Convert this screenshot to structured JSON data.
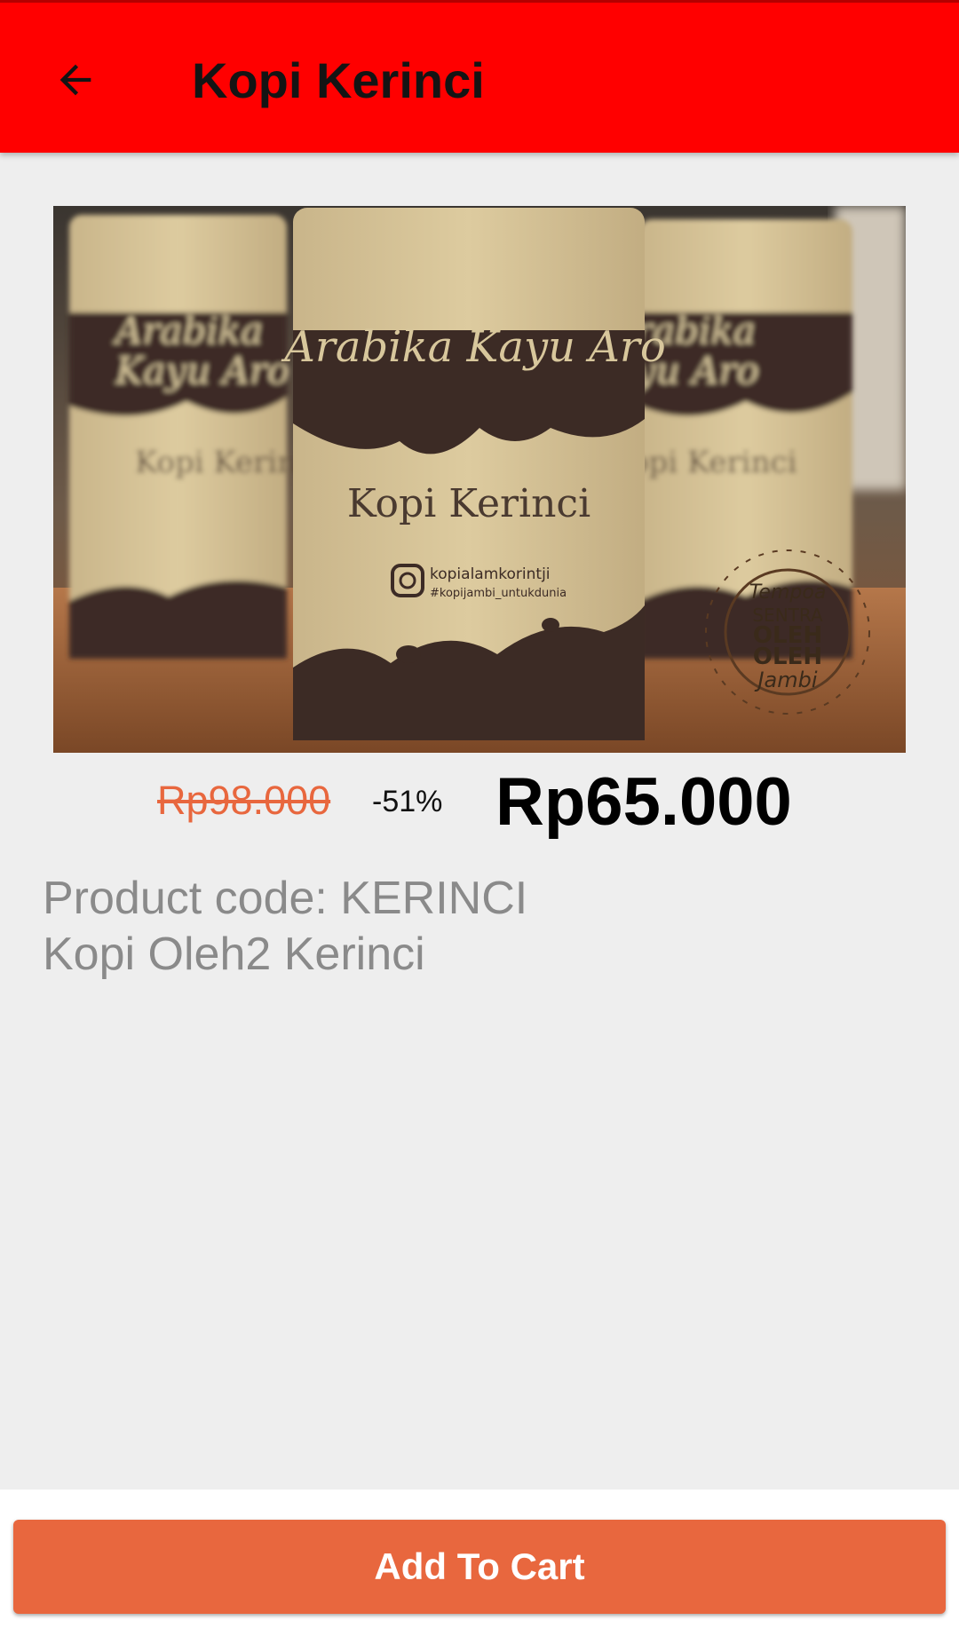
{
  "app_bar": {
    "title": "Kopi Kerinci",
    "back_icon": "arrow-left-icon",
    "background": "#ff0000"
  },
  "product": {
    "image": {
      "pouch_script": "Arabika Kayu Aro",
      "pouch_title": "Kopi Kerinci",
      "pouch_social": "kopialamkorintji",
      "pouch_hashtag": "#kopijambi_untukdunia",
      "watermark": "Tempoa SENTRA OLEH OLEH Jambi"
    },
    "old_price": "Rp98.000",
    "discount": "-51%",
    "price": "Rp65.000",
    "code": "Product code: KERINCI",
    "description": "Kopi Oleh2 Kerinci"
  },
  "actions": {
    "add_to_cart_label": "Add To Cart",
    "button_color": "#e8673e"
  }
}
